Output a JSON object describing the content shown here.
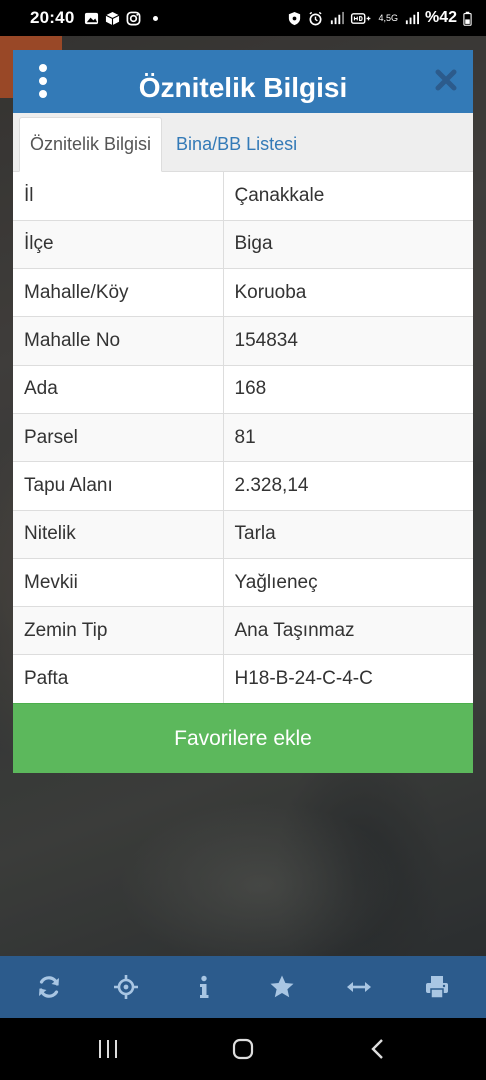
{
  "status_bar": {
    "time": "20:40",
    "network_small": "4,5G",
    "battery": "%42",
    "left_icons": [
      "gallery-icon",
      "box-icon",
      "instagram-icon"
    ],
    "right_icons": [
      "vpn-icon",
      "alarm-icon",
      "signal-icon",
      "hd-voice-icon",
      "signal-icon"
    ]
  },
  "dialog": {
    "title": "Öznitelik Bilgisi",
    "tabs": [
      {
        "label": "Öznitelik Bilgisi",
        "active": true
      },
      {
        "label": "Bina/BB Listesi",
        "active": false
      }
    ],
    "rows": [
      {
        "key": "İl",
        "value": "Çanakkale"
      },
      {
        "key": "İlçe",
        "value": "Biga"
      },
      {
        "key": "Mahalle/Köy",
        "value": "Koruoba"
      },
      {
        "key": "Mahalle No",
        "value": "154834"
      },
      {
        "key": "Ada",
        "value": "168"
      },
      {
        "key": "Parsel",
        "value": "81"
      },
      {
        "key": "Tapu Alanı",
        "value": "2.328,14"
      },
      {
        "key": "Nitelik",
        "value": "Tarla"
      },
      {
        "key": "Mevkii",
        "value": "Yağlıeneç"
      },
      {
        "key": "Zemin Tip",
        "value": "Ana Taşınmaz"
      },
      {
        "key": "Pafta",
        "value": "H18-B-24-C-4-C"
      }
    ],
    "favorite_button": "Favorilere ekle"
  },
  "toolbar": {
    "icons": [
      "refresh-icon",
      "locate-icon",
      "info-icon",
      "star-icon",
      "measure-icon",
      "print-icon"
    ]
  },
  "colors": {
    "header": "#337ab7",
    "toolbar": "#2c5b8c",
    "favorite": "#5cb85c",
    "tab_link": "#337ab7"
  }
}
